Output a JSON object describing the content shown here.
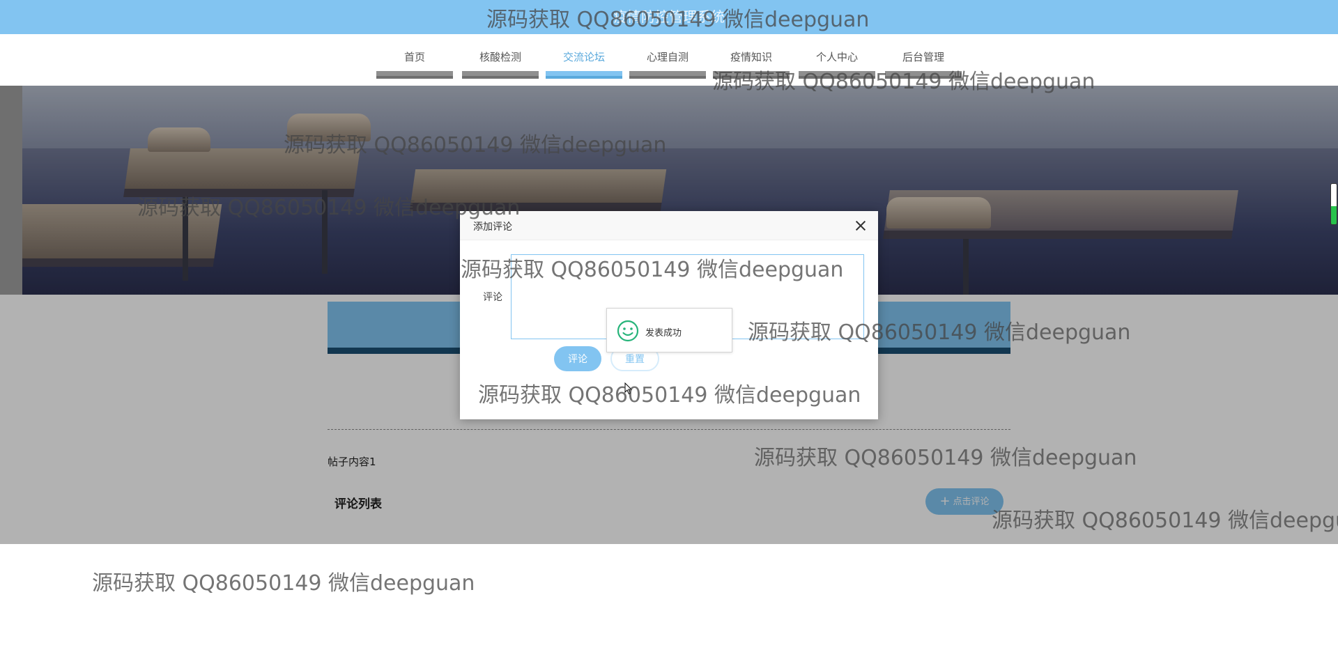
{
  "header": {
    "site_title": "疫情防控管理系统"
  },
  "nav": {
    "items": [
      {
        "label": "首页",
        "active": false
      },
      {
        "label": "核酸检测",
        "active": false
      },
      {
        "label": "交流论坛",
        "active": true
      },
      {
        "label": "心理自测",
        "active": false
      },
      {
        "label": "疫情知识",
        "active": false
      },
      {
        "label": "个人中心",
        "active": false
      },
      {
        "label": "后台管理",
        "active": false
      }
    ]
  },
  "post": {
    "content": "帖子内容1",
    "comments_title": "评论列表",
    "add_comment_label": "点击评论"
  },
  "dialog": {
    "title": "添加评论",
    "comment_label": "评论",
    "comment_value": "",
    "submit_label": "评论",
    "reset_label": "重置"
  },
  "toast": {
    "message": "发表成功",
    "icon": "smile-icon"
  },
  "watermark": {
    "text": "源码获取 QQ86050149 微信deepguan"
  },
  "colors": {
    "accent": "#82c4f1",
    "accent_dark": "#5aa9dc",
    "strip_border": "#1b4f73"
  }
}
